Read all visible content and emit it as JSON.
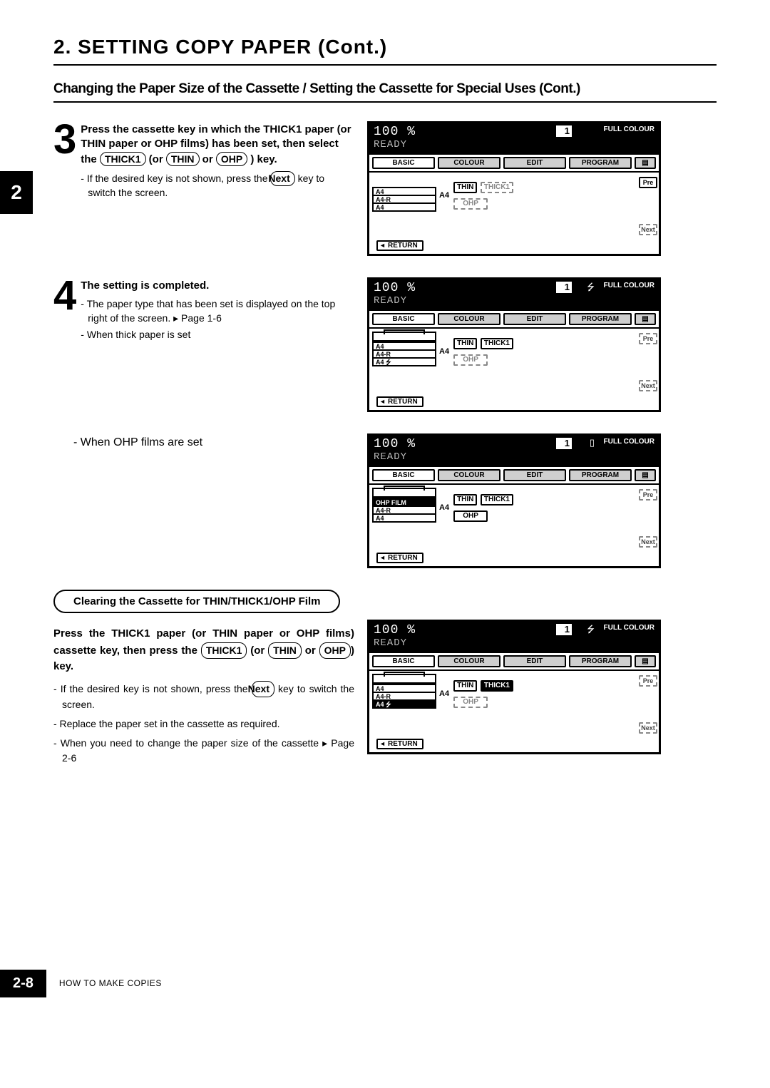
{
  "title": "2. SETTING COPY PAPER (Cont.)",
  "subtitle": "Changing the Paper Size of the Cassette / Setting the Cassette for Special Uses (Cont.)",
  "chapter_tab": "2",
  "step3": {
    "num": "3",
    "lead_pre": "Press the cassette key in which the THICK1 paper (or THIN paper or OHP films) has been set, then select the ",
    "key1": "THICK1",
    "mid1": " (or ",
    "key2": "THIN",
    "mid2": " or ",
    "key3": "OHP",
    "lead_post": " ) key.",
    "note_pre": "- If the desired key is not shown, press the ",
    "note_key": "Next",
    "note_post": " key to switch the screen."
  },
  "step4": {
    "num": "4",
    "lead": "The setting is completed.",
    "note1_pre": "- The paper type that has been set is displayed on the top right of the screen. ▸ ",
    "note1_ref": "Page 1-6",
    "note2": "- When thick paper is set",
    "note3": "- When OHP films are set"
  },
  "clearing": {
    "heading": "Clearing the Cassette for THIN/THICK1/OHP Film",
    "lead_pre": "Press the THICK1 paper (or THIN paper or OHP films) cassette key, then press the ",
    "key1": "THICK1",
    "mid1": " (or ",
    "key2": "THIN",
    "mid2": " or ",
    "key3": "OHP",
    "lead_post": ") key.",
    "note1_pre": "- If the desired key is not shown, press the ",
    "note1_key": "Next",
    "note1_post": " key to switch the screen.",
    "note2": "- Replace the paper set in the cassette as required.",
    "note3_pre": "- When you need to change the paper size of the cassette ▸ ",
    "note3_ref": "Page 2-6"
  },
  "screen_common": {
    "zoom": "100 %",
    "ready": "READY",
    "qty": "1",
    "mode": "FULL COLOUR",
    "tabs": {
      "basic": "BASIC",
      "colour": "COLOUR",
      "edit": "EDIT",
      "program": "PROGRAM"
    },
    "thin": "THIN",
    "thick1": "THICK1",
    "ohp": "OHP",
    "a4": "A4",
    "a4r": "A4-R",
    "pre": "Pre",
    "next": "Next",
    "return": "RETURN",
    "ohpfilm": "OHP FILM"
  },
  "footer": {
    "page": "2-8",
    "section": "HOW TO MAKE COPIES"
  }
}
